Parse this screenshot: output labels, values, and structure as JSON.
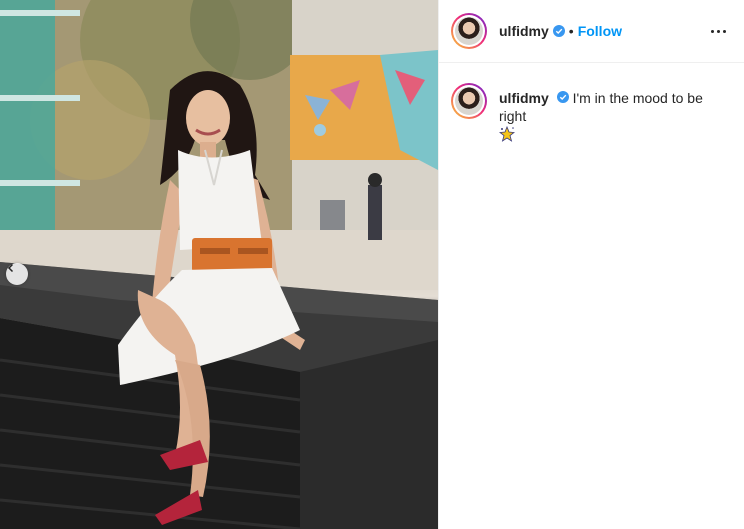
{
  "post": {
    "account": {
      "username": "ulfidmy",
      "verified": true,
      "avatar_icon": "profile-photo"
    },
    "header": {
      "separator": "•",
      "follow_label": "Follow",
      "more_icon": "more-options-icon"
    },
    "caption": {
      "username": "ulfidmy",
      "text": "I'm in the mood to be right",
      "emoji_icon": "sparkling-star-emoji"
    },
    "media": {
      "description_icon": "photo",
      "carousel_prev_icon": "chevron-left-icon"
    }
  },
  "colors": {
    "accent": "#0095f6",
    "text": "#262626",
    "border": "#efefef",
    "dress": "#f4f3f1",
    "belt": "#d9742f",
    "shoes": "#b4243b"
  }
}
